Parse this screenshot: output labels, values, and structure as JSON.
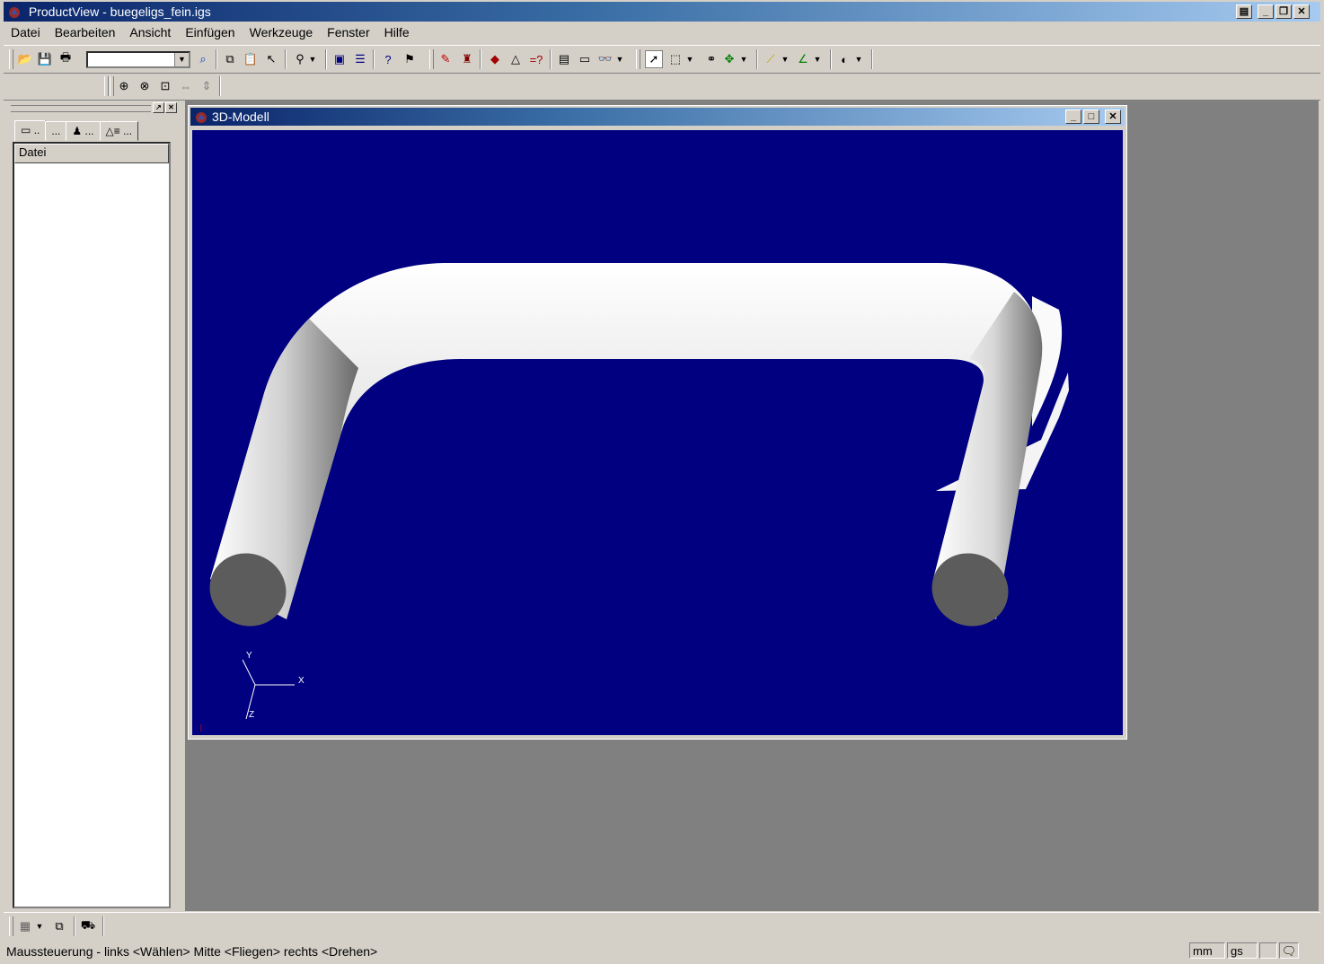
{
  "window": {
    "title": "ProductView - buegeligs_fein.igs"
  },
  "menu": [
    "Datei",
    "Bearbeiten",
    "Ansicht",
    "Einfügen",
    "Werkzeuge",
    "Fenster",
    "Hilfe"
  ],
  "panel": {
    "tabs": [
      "..",
      "...",
      "...",
      "..."
    ],
    "column_header": "Datei"
  },
  "child_window": {
    "title": "3D-Modell"
  },
  "viewport": {
    "background": "#000080",
    "axes": {
      "x": "X",
      "y": "Y",
      "z": "Z"
    }
  },
  "status": {
    "message": "Maussteuerung - links <Wählen> Mitte <Fliegen> rechts <Drehen>",
    "unit": "mm",
    "mode": "gs"
  },
  "icons": {
    "toolbar1": [
      "open-icon",
      "save-icon",
      "print-icon",
      "find-icon",
      "copy-icon",
      "paste-icon",
      "pick-icon",
      "zoom-icon",
      "cascade-icon",
      "tile-icon",
      "help-icon",
      "query-icon",
      "markup-icon",
      "stamp-icon",
      "section-icon",
      "compare-icon",
      "properties-icon",
      "note-icon",
      "binoculars-icon",
      "select-icon",
      "region-icon",
      "link-icon",
      "explode-icon",
      "measure-icon",
      "angle-icon",
      "shading-icon"
    ],
    "toolbar2": [
      "zoom-in-icon",
      "zoom-area-icon",
      "fit-icon",
      "fit-width-icon",
      "fit-height-icon"
    ]
  }
}
